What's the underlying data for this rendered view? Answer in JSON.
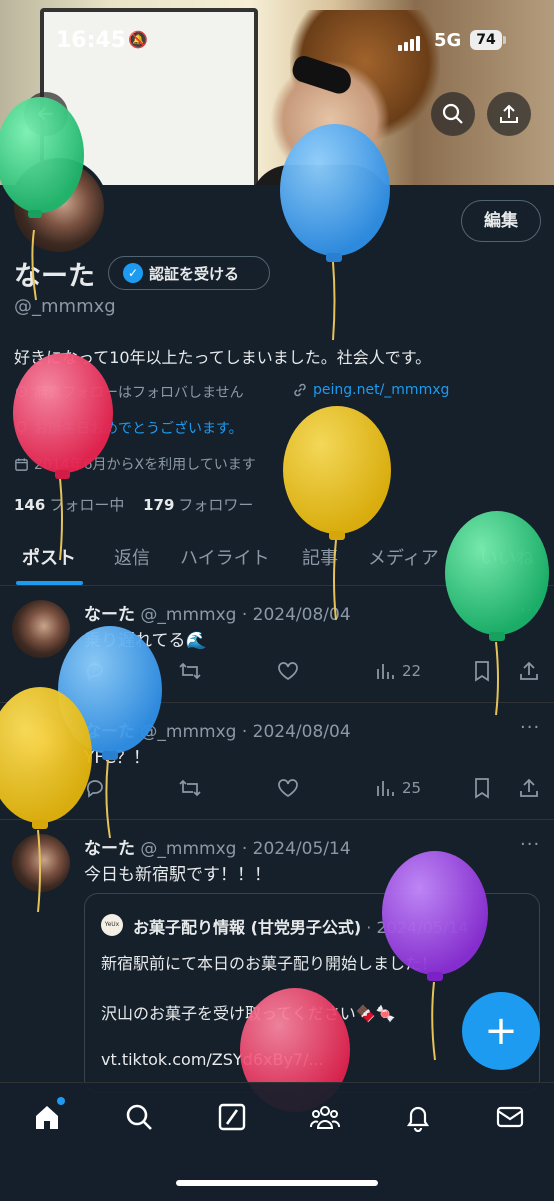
{
  "status": {
    "time": "16:45",
    "network": "5G",
    "battery": "74"
  },
  "profile": {
    "name": "なーた",
    "verify_label": "認証を受ける",
    "handle": "@_mmmxg",
    "edit_label": "編集",
    "bio": "好きになって10年以上たってしまいました。社会人です。",
    "meta": {
      "note": "無言フォローはフォロバしません",
      "link": "peing.net/_mmmxg",
      "birthday": "お誕生日おめでとうございます。",
      "joined": "2014年6月からXを利用しています"
    },
    "following_count": "146",
    "following_label": "フォロー中",
    "followers_count": "179",
    "followers_label": "フォロワー"
  },
  "tabs": [
    {
      "label": "ポスト",
      "active": true
    },
    {
      "label": "返信"
    },
    {
      "label": "ハイライト"
    },
    {
      "label": "記事"
    },
    {
      "label": "メディア"
    },
    {
      "label": "いいね"
    }
  ],
  "posts": [
    {
      "name": "なーた",
      "handle": "@_mmmxg · 2024/08/04",
      "text": "乗り遅れてる🌊",
      "views": "22"
    },
    {
      "name": "なーた",
      "handle": "@_mmmxg · 2024/08/04",
      "text": "YFC？！",
      "views": "25"
    },
    {
      "name": "なーた",
      "handle": "@_mmmxg · 2024/05/14",
      "text": "今日も新宿駅です！！！",
      "quote": {
        "avatar_text": "YeUx",
        "name": "お菓子配り情報 (甘党男子公式)",
        "date": "· 2024/05/14",
        "line1": "新宿駅前にて本日のお菓子配り開始しました！",
        "line2": "沢山のお菓子を受け取ってください🍫🍬",
        "line3": "vt.tiktok.com/ZSYd6xBy7/..."
      }
    }
  ],
  "fab_label": "+",
  "colors": {
    "accent": "#1d9bf0",
    "background": "#15202b",
    "muted": "#8b98a5"
  },
  "nav": [
    "home-icon",
    "search-icon",
    "grok-icon",
    "communities-icon",
    "notifications-icon",
    "messages-icon"
  ]
}
